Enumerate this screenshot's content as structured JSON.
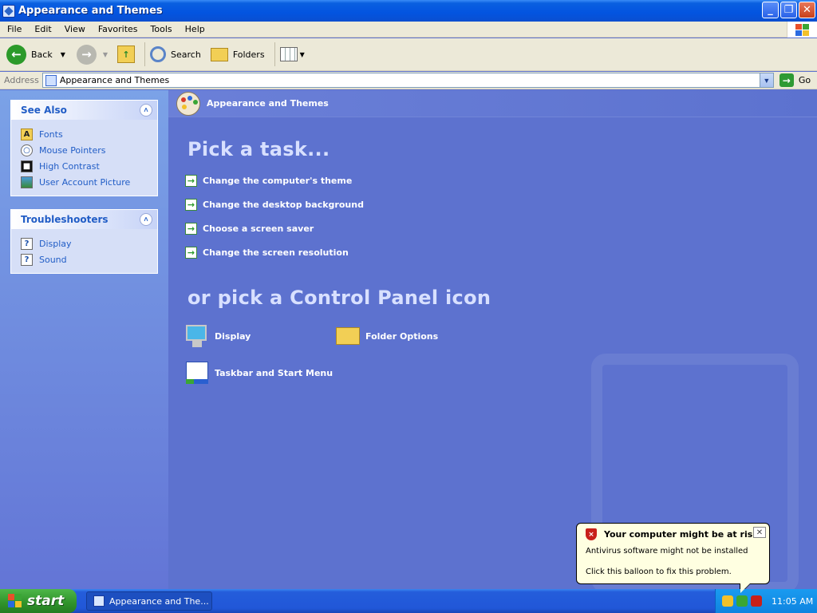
{
  "window": {
    "title": "Appearance and Themes",
    "min": "_",
    "max": "❐",
    "close": "✕"
  },
  "menu": [
    "File",
    "Edit",
    "View",
    "Favorites",
    "Tools",
    "Help"
  ],
  "toolbar": {
    "back": "Back",
    "search": "Search",
    "folders": "Folders"
  },
  "address": {
    "label": "Address",
    "value": "Appearance and Themes",
    "go": "Go"
  },
  "see_also": {
    "title": "See Also",
    "items": [
      "Fonts",
      "Mouse Pointers",
      "High Contrast",
      "User Account Picture"
    ]
  },
  "troubleshooters": {
    "title": "Troubleshooters",
    "items": [
      "Display",
      "Sound"
    ]
  },
  "main": {
    "header": "Appearance and Themes",
    "pick_task": "Pick a task...",
    "tasks": [
      "Change the computer's theme",
      "Change the desktop background",
      "Choose a screen saver",
      "Change the screen resolution"
    ],
    "pick_icon": "or pick a Control Panel icon",
    "icons": [
      "Display",
      "Folder Options",
      "Taskbar and Start Menu"
    ]
  },
  "balloon": {
    "title": "Your computer might be at risk",
    "line1": "Antivirus software might not be installed",
    "line2": "Click this balloon to fix this problem."
  },
  "taskbar": {
    "start": "start",
    "task": "Appearance and The...",
    "clock": "11:05 AM"
  },
  "colors": {
    "title_blue": "#0354e0",
    "main_bg": "#5d72cf",
    "link_blue": "#215dc6",
    "start_green": "#3a9f35"
  }
}
